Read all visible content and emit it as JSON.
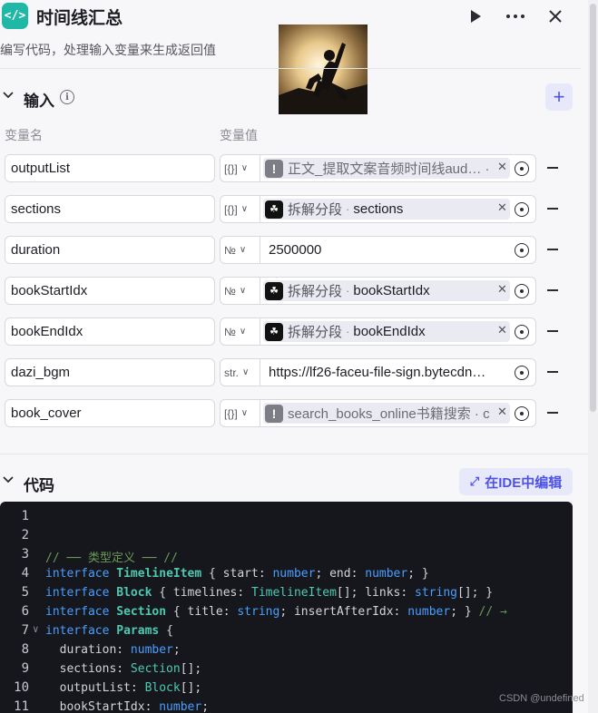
{
  "header": {
    "icon_glyph": "</>",
    "title": "时间线汇总",
    "run_icon": "play-icon",
    "more_icon": "more-icon",
    "close_icon": "close-icon"
  },
  "subtitle": "编写代码，处理输入变量来生成返回值",
  "input_section": {
    "label": "输入",
    "col_name": "变量名",
    "col_value": "变量值",
    "add_label": "+"
  },
  "rows": [
    {
      "name": "outputList",
      "type": "[{}]",
      "ref_kind": "warn",
      "ref_node": "正文_提取文案音频时间线aud… ·",
      "ref_var": ""
    },
    {
      "name": "sections",
      "type": "[{}]",
      "ref_kind": "node",
      "ref_node": "拆解分段",
      "ref_var": "sections"
    },
    {
      "name": "duration",
      "type": "№",
      "ref_kind": "plain",
      "value": "2500000"
    },
    {
      "name": "bookStartIdx",
      "type": "№",
      "ref_kind": "node",
      "ref_node": "拆解分段",
      "ref_var": "bookStartIdx"
    },
    {
      "name": "bookEndIdx",
      "type": "№",
      "ref_kind": "node",
      "ref_node": "拆解分段",
      "ref_var": "bookEndIdx"
    },
    {
      "name": "dazi_bgm",
      "type": "str.",
      "ref_kind": "plain",
      "value": "https://lf26-faceu-file-sign.bytecdn…"
    },
    {
      "name": "book_cover",
      "type": "[{}]",
      "ref_kind": "warn",
      "ref_node": "search_books_online书籍搜索 · c",
      "ref_var": ""
    }
  ],
  "code_section": {
    "label": "代码",
    "ide_button": "在IDE中编辑"
  },
  "code_lines": [
    {
      "n": "1",
      "text": ""
    },
    {
      "n": "2",
      "text": ""
    },
    {
      "n": "3",
      "text": "// ── 类型定义 ── //"
    },
    {
      "n": "4",
      "text": "interface TimelineItem { start: number; end: number; }"
    },
    {
      "n": "5",
      "text": "interface Block { timelines: TimelineItem[]; links: string[]; }"
    },
    {
      "n": "6",
      "text": "interface Section { title: string; insertAfterIdx: number; } // →"
    },
    {
      "n": "7",
      "text": "interface Params {"
    },
    {
      "n": "8",
      "text": "  duration: number;"
    },
    {
      "n": "9",
      "text": "  sections: Section[];"
    },
    {
      "n": "10",
      "text": "  outputList: Block[];"
    },
    {
      "n": "11",
      "text": "  bookStartIdx: number;"
    }
  ],
  "watermark": "CSDN @undefined",
  "colors": {
    "accent": "#4d53e8",
    "node_icon": "#1fb7a6",
    "code_bg": "#15171d"
  }
}
